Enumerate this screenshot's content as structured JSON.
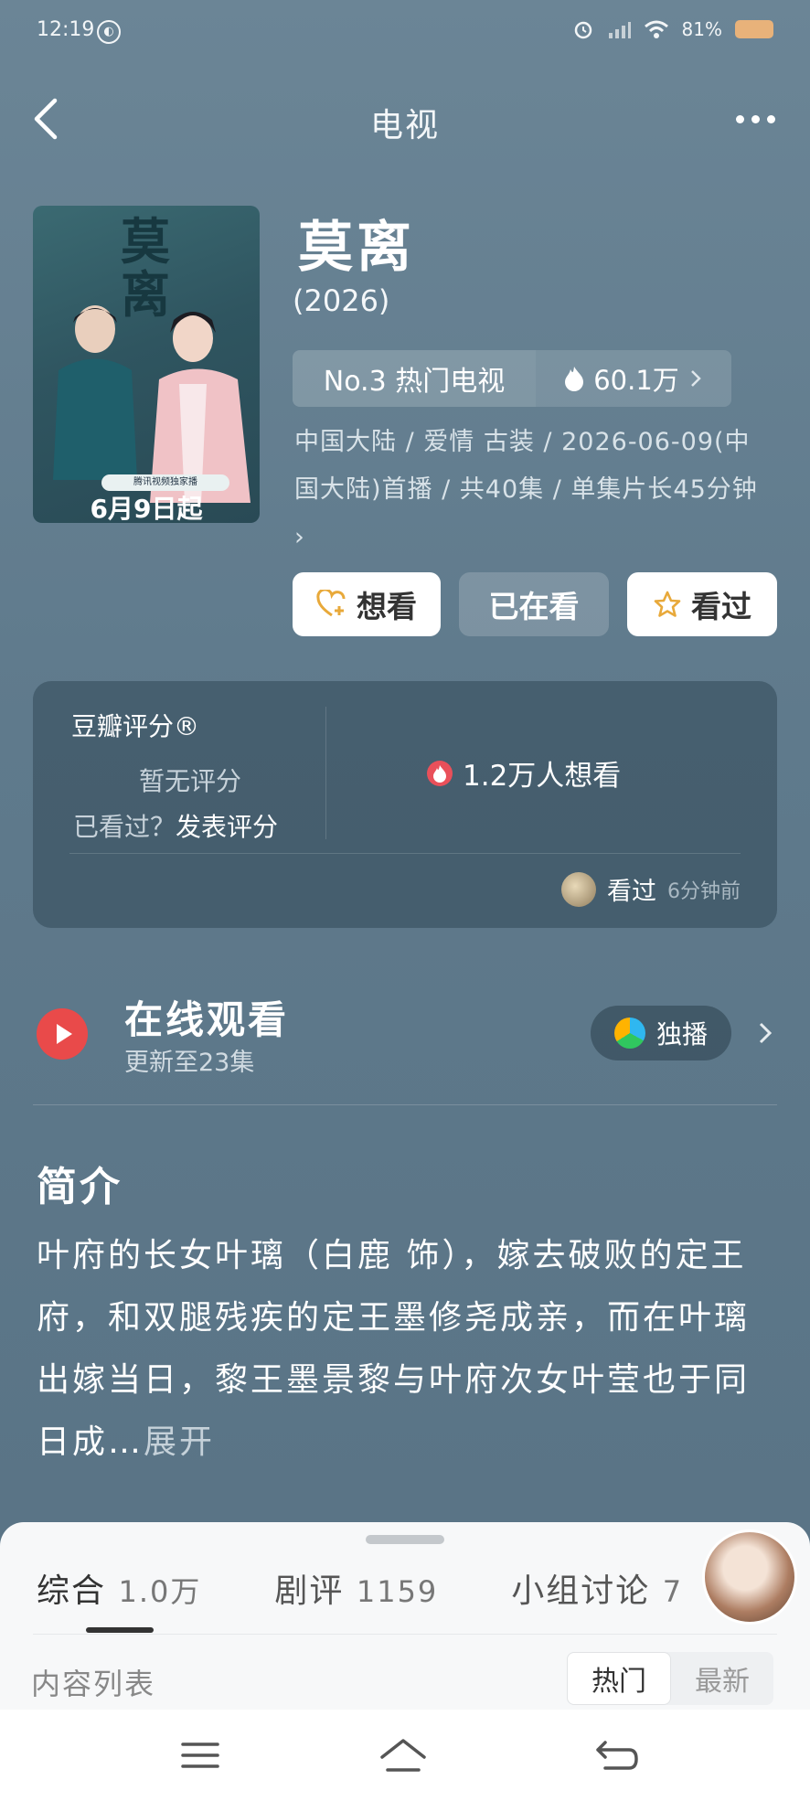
{
  "status_bar": {
    "time": "12:19",
    "battery": "81%"
  },
  "nav": {
    "title": "电视"
  },
  "poster": {
    "title": "莫离",
    "badge": "腾讯视频独家播",
    "date": "6月9日起"
  },
  "show": {
    "title": "莫离",
    "year": "(2026)",
    "rank": "No.3 热门电视",
    "heat": "60.1万",
    "meta": "中国大陆 / 爱情 古装 / 2026-06-09(中国大陆)首播 / 共40集 / 单集片长45分钟 ›"
  },
  "actions": {
    "want": "想看",
    "watching": "已在看",
    "watched": "看过"
  },
  "rating": {
    "label": "豆瓣评分®",
    "none": "暂无评分",
    "seen_prompt": "已看过？",
    "post_link": "发表评分",
    "want_count": "1.2万人想看",
    "friend_action": "看过",
    "friend_time": "6分钟前"
  },
  "online": {
    "title": "在线观看",
    "subtitle": "更新至23集",
    "platform_label": "独播"
  },
  "intro": {
    "heading": "简介",
    "text": "叶府的长女叶璃（白鹿 饰），嫁去破败的定王府，和双腿残疾的定王墨修尧成亲，而在叶璃出嫁当日，黎王墨景黎与叶府次女叶莹也于同日成…",
    "more": "展开"
  },
  "sheet": {
    "tabs": [
      {
        "label": "综合",
        "count": "1.0万"
      },
      {
        "label": "剧评",
        "count": "1159"
      },
      {
        "label": "小组讨论",
        "count": "7"
      }
    ],
    "list_title": "内容列表",
    "sort_hot": "热门",
    "sort_new": "最新"
  },
  "colors": {
    "background": "#6b8596",
    "accent_red": "#e94a4a",
    "star_yellow": "#f3b323"
  }
}
